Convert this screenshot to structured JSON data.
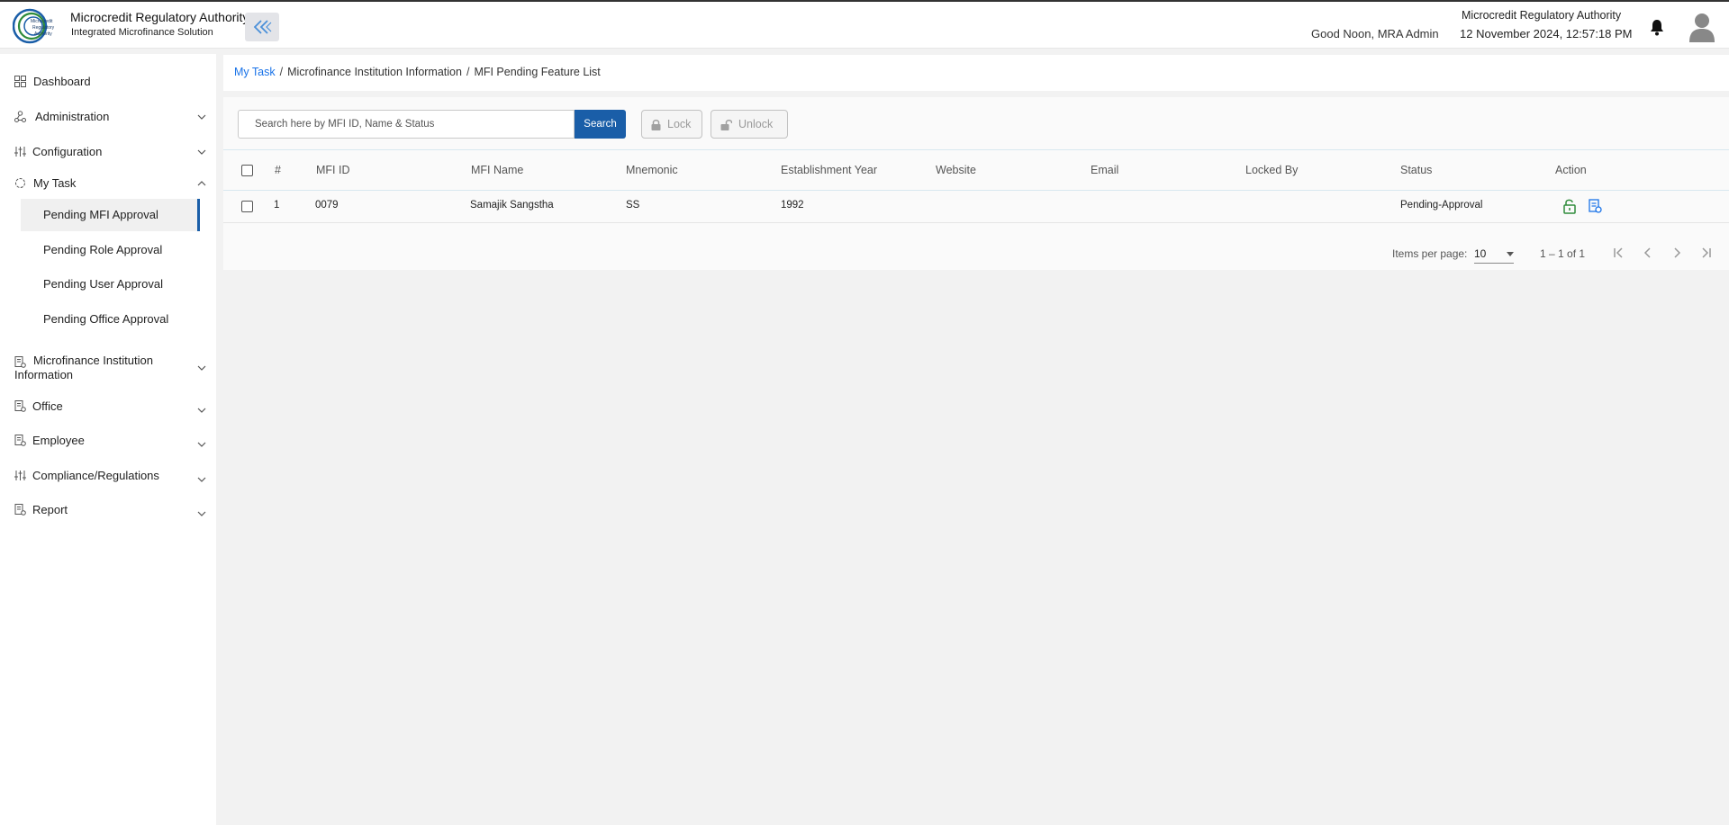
{
  "header": {
    "logo_text": "Microcredit Regulatory Authority",
    "brand_title": "Microcredit Regulatory Authority",
    "brand_subtitle": "Integrated Microfinance Solution",
    "greeting": "Good Noon, MRA Admin",
    "org_name": "Microcredit Regulatory Authority",
    "datetime": "12 November 2024, 12:57:18 PM"
  },
  "sidebar": {
    "items": [
      {
        "label": "Dashboard",
        "icon": "grid-icon"
      },
      {
        "label": "Administration",
        "icon": "nodes-icon"
      },
      {
        "label": "Configuration",
        "icon": "sliders-icon"
      },
      {
        "label": "My Task",
        "icon": "spinner-icon"
      },
      {
        "label": "Microfinance Institution Information",
        "icon": "document-icon"
      },
      {
        "label": "Office",
        "icon": "document-icon"
      },
      {
        "label": "Employee",
        "icon": "document-icon"
      },
      {
        "label": "Compliance/Regulations",
        "icon": "sliders-icon"
      },
      {
        "label": "Report",
        "icon": "document-icon"
      }
    ],
    "my_task_sub": [
      {
        "label": "Pending MFI Approval"
      },
      {
        "label": "Pending Role Approval"
      },
      {
        "label": "Pending User Approval"
      },
      {
        "label": "Pending Office Approval"
      }
    ]
  },
  "breadcrumb": {
    "items": [
      "My Task",
      "Microfinance Institution Information",
      "MFI Pending Feature List"
    ],
    "separator": "/"
  },
  "toolbar": {
    "search_placeholder": "Search here by MFI ID, Name & Status",
    "search_label": "Search",
    "lock_label": "Lock",
    "unlock_label": "Unlock"
  },
  "table": {
    "columns": [
      "#",
      "MFI ID",
      "MFI Name",
      "Mnemonic",
      "Establishment Year",
      "Website",
      "Email",
      "Locked By",
      "Status",
      "Action"
    ],
    "rows": [
      {
        "index": "1",
        "mfi_id": "0079",
        "mfi_name": "Samajik Sangstha",
        "mnemonic": "SS",
        "establishment_year": "1992",
        "website": "",
        "email": "",
        "locked_by": "",
        "status": "Pending-Approval"
      }
    ]
  },
  "pagination": {
    "items_per_page_label": "Items per page:",
    "items_per_page": "10",
    "range": "1 – 1 of 1"
  },
  "colors": {
    "primary": "#1a5ea8",
    "link": "#1a73e8",
    "unlock_icon": "#2e8b3a",
    "view_icon": "#1a73e8"
  }
}
